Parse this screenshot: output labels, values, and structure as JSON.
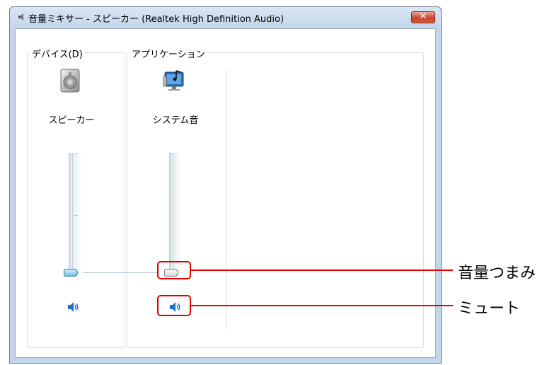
{
  "window": {
    "title": "音量ミキサー - スピーカー (Realtek High Definition Audio)",
    "close_label": "✕"
  },
  "device_group": {
    "label": "デバイス(D)",
    "channel_name": "スピーカー",
    "icon": "speaker-device-icon",
    "volume": 0.0,
    "mute_icon": "speaker-mute-icon"
  },
  "app_group": {
    "label": "アプリケーション",
    "channel_name": "システム音",
    "icon": "system-sounds-icon",
    "volume": 0.0,
    "mute_icon": "speaker-mute-icon"
  },
  "callouts": {
    "volume_knob": "音量つまみ",
    "mute": "ミュート"
  },
  "colors": {
    "callout": "#e00000",
    "mute_icon": "#1e6fd0"
  }
}
